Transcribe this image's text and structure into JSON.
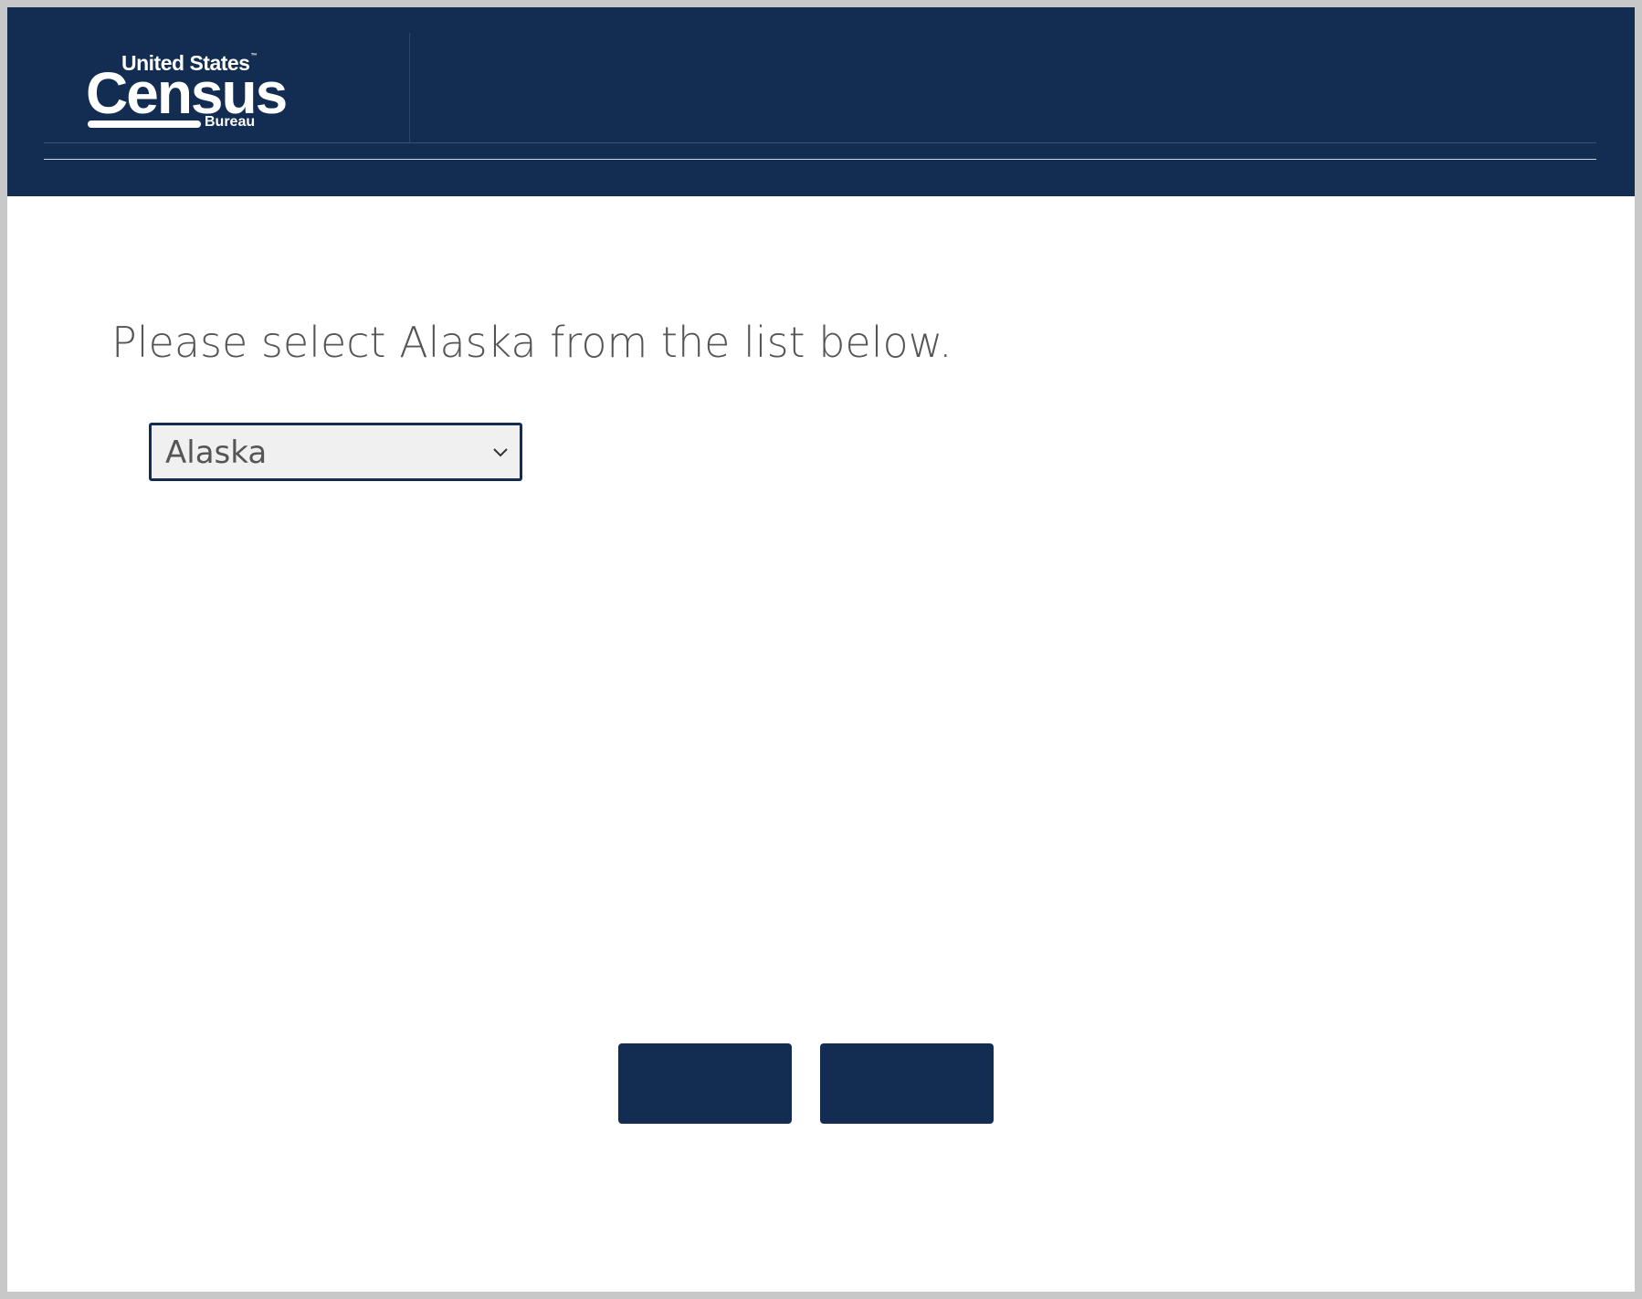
{
  "header": {
    "logo": {
      "top_text": "United States",
      "tm": "™",
      "main_text": "Census",
      "sub_text": "Bureau"
    }
  },
  "main": {
    "prompt": "Please select Alaska from the list below.",
    "state_select": {
      "selected_value": "Alaska"
    }
  },
  "navigation": {
    "back_label": "",
    "next_label": ""
  },
  "colors": {
    "brand_navy": "#122d51",
    "select_background": "#f0f0f0",
    "text_gray": "#555555"
  },
  "icons": {
    "select_arrow": "chevron-down-icon"
  }
}
